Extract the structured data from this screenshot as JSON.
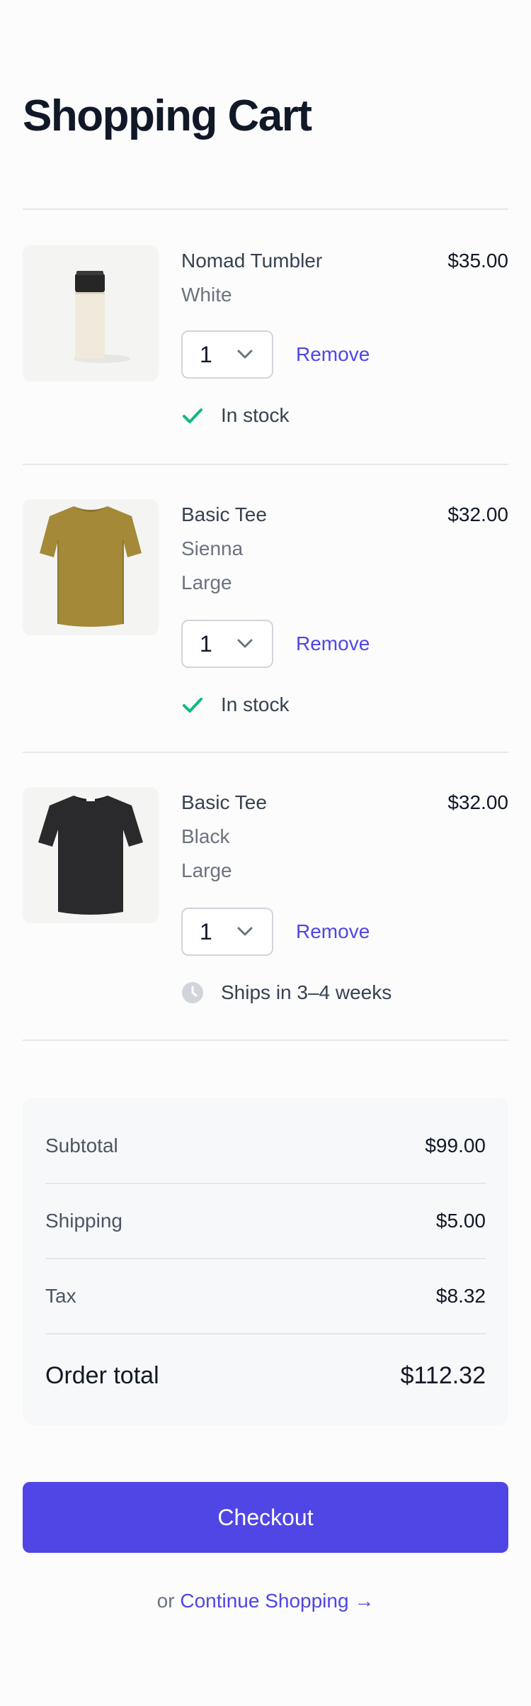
{
  "page": {
    "title": "Shopping Cart"
  },
  "cart": {
    "items": [
      {
        "name": "Nomad Tumbler",
        "price": "$35.00",
        "attributes": [
          "White"
        ],
        "quantity": "1",
        "remove_label": "Remove",
        "availability": {
          "status": "in-stock",
          "icon": "check-icon",
          "text": "In stock"
        }
      },
      {
        "name": "Basic Tee",
        "price": "$32.00",
        "attributes": [
          "Sienna",
          "Large"
        ],
        "quantity": "1",
        "remove_label": "Remove",
        "availability": {
          "status": "in-stock",
          "icon": "check-icon",
          "text": "In stock"
        }
      },
      {
        "name": "Basic Tee",
        "price": "$32.00",
        "attributes": [
          "Black",
          "Large"
        ],
        "quantity": "1",
        "remove_label": "Remove",
        "availability": {
          "status": "backorder",
          "icon": "clock-icon",
          "text": "Ships in 3–4 weeks"
        }
      }
    ]
  },
  "summary": {
    "rows": [
      {
        "label": "Subtotal",
        "value": "$99.00"
      },
      {
        "label": "Shipping",
        "value": "$5.00"
      },
      {
        "label": "Tax",
        "value": "$8.32"
      }
    ],
    "total": {
      "label": "Order total",
      "value": "$112.32"
    }
  },
  "actions": {
    "checkout_label": "Checkout",
    "continue_prefix": "or",
    "continue_label": "Continue Shopping →"
  },
  "colors": {
    "accent": "#4f46e5",
    "in_stock": "#10b981",
    "backorder_icon": "#d1d5db",
    "heading": "#111827",
    "muted": "#6b7280"
  }
}
